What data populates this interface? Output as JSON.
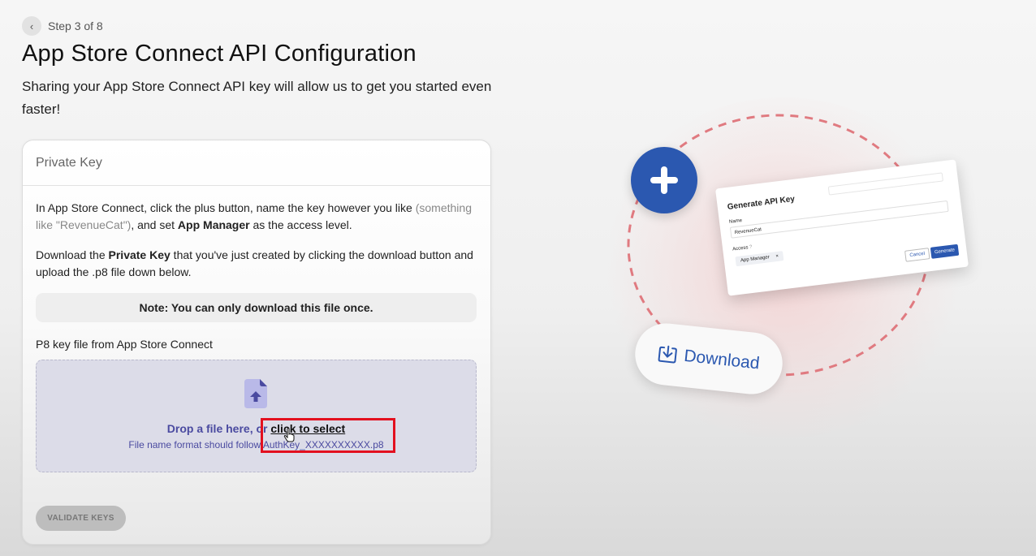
{
  "header": {
    "back_icon": "chevron-left-icon",
    "step": "Step 3 of 8",
    "title": "App Store Connect API Configuration",
    "subtitle": "Sharing your App Store Connect API key will allow us to get you started even faster!"
  },
  "card": {
    "title": "Private Key",
    "instruction1_part1": "In App Store Connect, click the plus button, name the key however you like ",
    "instruction1_example": "(something like \"RevenueCat\")",
    "instruction1_part2": ", and set ",
    "instruction1_bold": "App Manager",
    "instruction1_part3": " as the access level.",
    "instruction2_part1": "Download the ",
    "instruction2_bold": "Private Key",
    "instruction2_part2": " that you've just created by clicking the download button and upload the .p8 file down below.",
    "note": "Note: You can only download this file once.",
    "field_label": "P8 key file from App Store Connect",
    "dropzone": {
      "icon": "file-upload-icon",
      "text": "Drop a file here, or ",
      "link": "click to select",
      "hint": "File name format should follow AuthKey_XXXXXXXXXX.p8"
    },
    "validate_button": "VALIDATE KEYS"
  },
  "illustration": {
    "plus_icon": "plus-icon",
    "api_card": {
      "title": "Generate API Key",
      "name_label": "Name",
      "name_value": "RevenueCat",
      "access_label": "Access",
      "access_hint": "?",
      "access_chip": "App Manager",
      "chip_close": "×",
      "cancel": "Cancel",
      "generate": "Generate"
    },
    "download_icon": "download-icon",
    "download_label": "Download"
  },
  "colors": {
    "accent": "#2b58b0",
    "dropzone_text": "#4a4aa0",
    "highlight": "#e3101f",
    "dashed_circle": "#e07a80"
  }
}
